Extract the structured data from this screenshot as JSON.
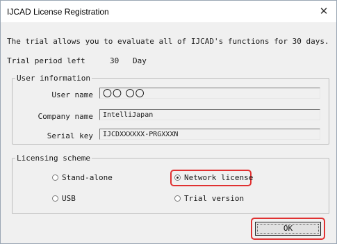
{
  "window": {
    "title": "IJCAD License Registration",
    "close_icon": "close-icon"
  },
  "intro": "The trial allows you to evaluate all of IJCAD's functions for 30 days.",
  "trial": {
    "label": "Trial period left",
    "value": "30",
    "unit": "Day"
  },
  "user_info": {
    "legend": "User information",
    "user_name_label": "User name",
    "user_name_value": "〇〇 〇〇",
    "company_label": "Company name",
    "company_value": "IntelliJapan",
    "serial_label": "Serial key",
    "serial_value": "IJCDXXXXXX-PRGXXXN"
  },
  "licensing": {
    "legend": "Licensing scheme",
    "options": [
      {
        "label": "Stand-alone",
        "selected": false
      },
      {
        "label": "Network license",
        "selected": true
      },
      {
        "label": "USB",
        "selected": false
      },
      {
        "label": "Trial version",
        "selected": false
      }
    ]
  },
  "ok_label": "OK",
  "highlight_color": "#e03131"
}
